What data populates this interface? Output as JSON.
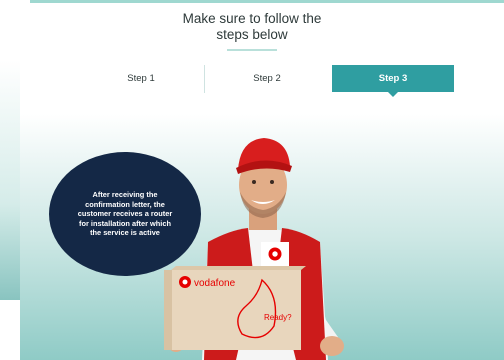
{
  "heading": {
    "line1": "Make sure to follow the",
    "line2": "steps below"
  },
  "tabs": [
    {
      "label": "Step 1",
      "active": false
    },
    {
      "label": "Step 2",
      "active": false
    },
    {
      "label": "Step 3",
      "active": true
    }
  ],
  "info": {
    "text": "After receiving the confirmation letter, the customer receives a router for installation after which the service is active"
  },
  "box": {
    "brand": "vodafone",
    "tagline": "Ready?"
  },
  "colors": {
    "accent": "#2f9ea1",
    "bubble": "#142846",
    "vodafone_red": "#e60000"
  }
}
